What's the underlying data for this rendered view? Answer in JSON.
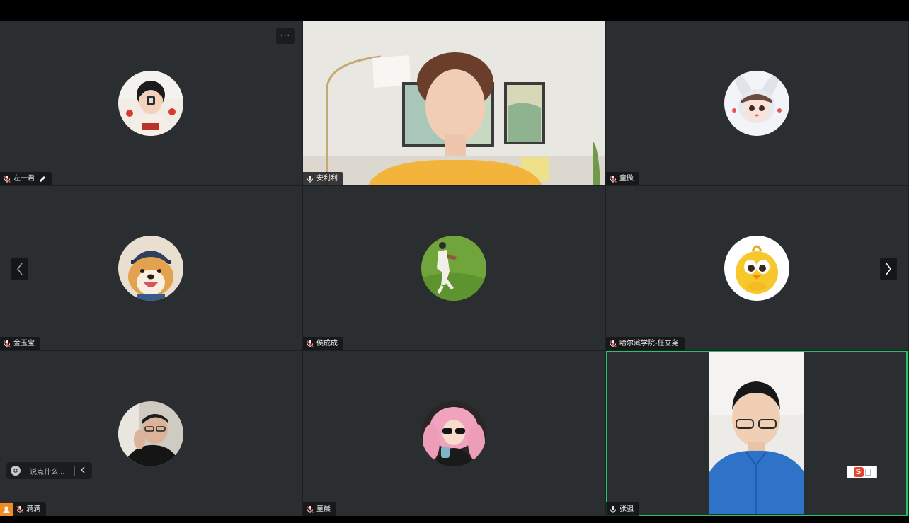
{
  "meeting": {
    "participants": [
      {
        "name": "左一君",
        "mic_muted": true,
        "has_pencil": true
      },
      {
        "name": "安利利",
        "mic_muted": false,
        "video_on": true
      },
      {
        "name": "童微",
        "mic_muted": true
      },
      {
        "name": "金玉宝",
        "mic_muted": true
      },
      {
        "name": "侯成成",
        "mic_muted": true
      },
      {
        "name": "哈尔滨学院-任立尧",
        "mic_muted": true
      },
      {
        "name": "满满",
        "mic_muted": true,
        "host": true
      },
      {
        "name": "童晨",
        "mic_muted": true
      },
      {
        "name": "张强",
        "mic_muted": false,
        "video_on": true,
        "active_speaker": true
      }
    ],
    "more_label": "···"
  },
  "chat": {
    "placeholder": "说点什么..."
  },
  "ime": {
    "label": "S"
  },
  "colors": {
    "tile_bg": "#2b2e31",
    "active_border": "#27c26a",
    "host_badge": "#f08a24",
    "muted_mic": "#e84a4a"
  },
  "icons": {
    "mic_muted": "mic-muted-icon",
    "mic_on": "mic-icon",
    "pencil": "pencil-icon",
    "prev": "chevron-left-icon",
    "next": "chevron-right-icon",
    "emoji": "emoji-icon",
    "collapse": "chevron-left-icon",
    "host": "person-icon"
  }
}
